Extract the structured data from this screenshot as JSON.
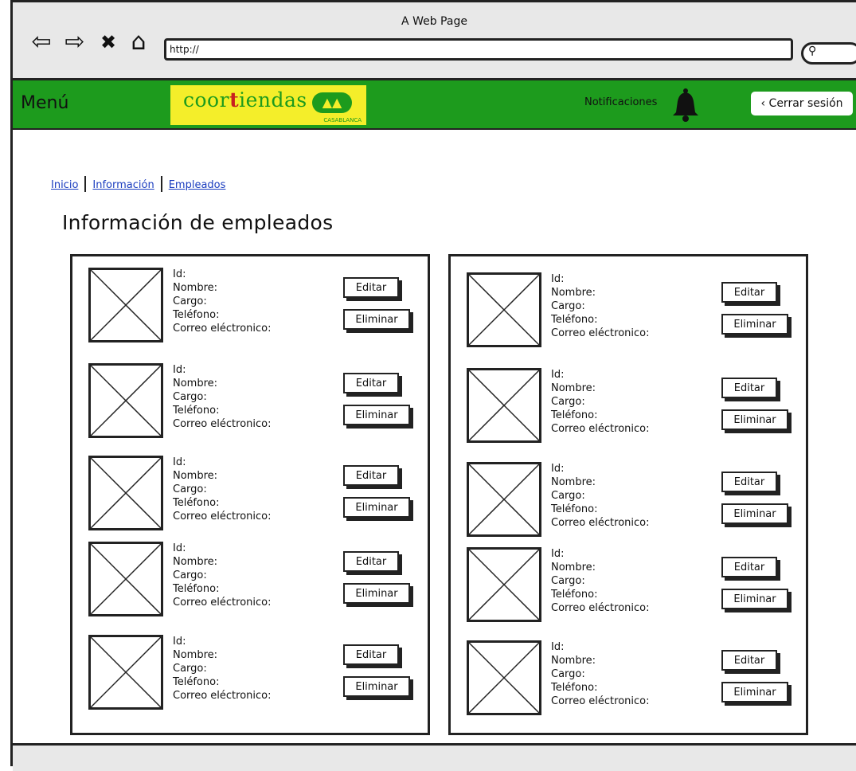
{
  "window": {
    "title": "A Web Page"
  },
  "browser": {
    "url": "http://",
    "back_icon": "arrow-left-icon",
    "forward_icon": "arrow-right-icon",
    "stop_icon": "close-icon",
    "home_icon": "home-icon"
  },
  "header": {
    "menu_label": "Menú",
    "logo": {
      "brand_pre": "coor",
      "brand_t": "t",
      "brand_post": "iendas",
      "sub": "CASABLANCA"
    },
    "notifications_label": "Notificaciones",
    "logout_label": "Cerrar sesión"
  },
  "breadcrumb": [
    "Inicio",
    "Información",
    "Empleados"
  ],
  "page_title": "Información de empleados",
  "field_labels": {
    "id": "Id:",
    "name": "Nombre:",
    "role": "Cargo:",
    "phone": "Teléfono:",
    "email": "Correo eléctronico:"
  },
  "buttons": {
    "edit": "Editar",
    "delete": "Eliminar"
  },
  "colors": {
    "green": "#1d9b1d",
    "yellow": "#f4ee2a",
    "red": "#c82020"
  },
  "employee_count_per_column": 5
}
